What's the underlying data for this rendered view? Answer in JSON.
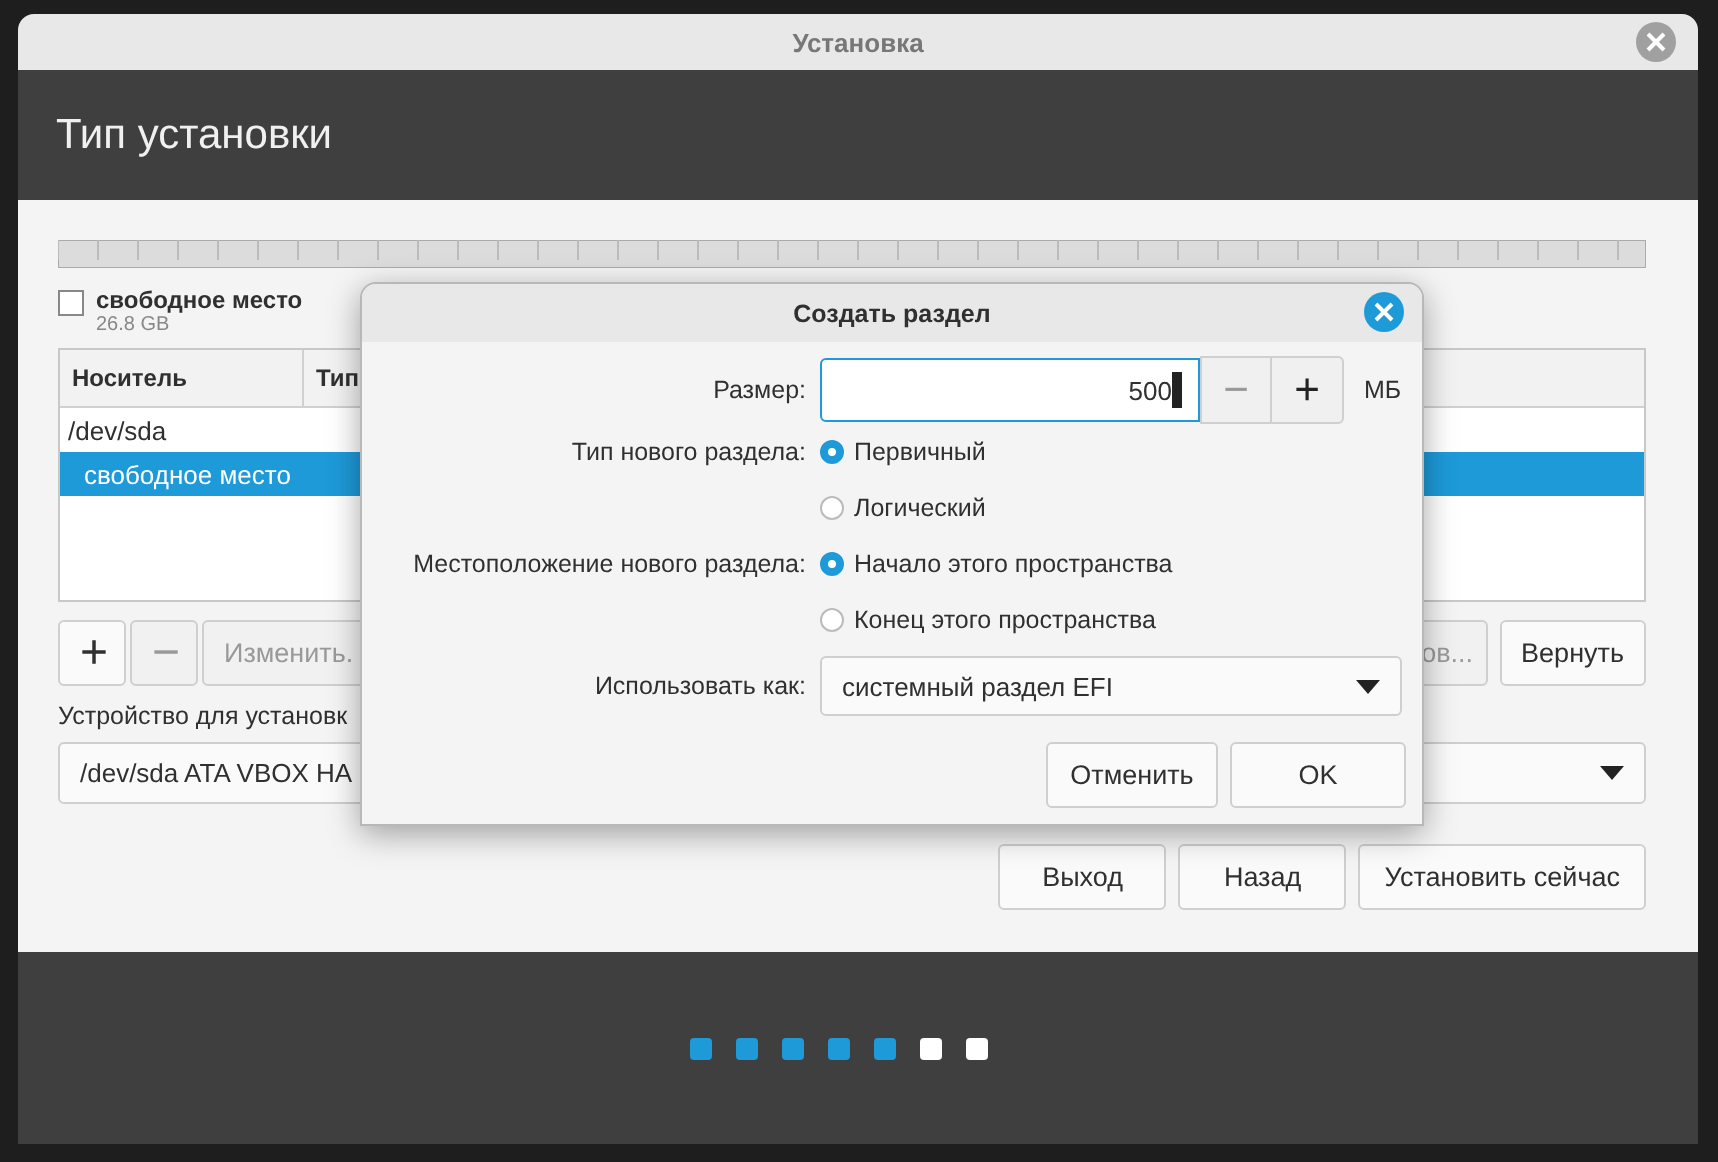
{
  "window": {
    "title": "Установка",
    "heading": "Тип установки"
  },
  "partition_legend": {
    "label": "свободное место",
    "size": "26.8 GB",
    "checked": false
  },
  "table": {
    "columns": [
      "Носитель",
      "Тип"
    ],
    "rows": [
      {
        "text": "/dev/sda",
        "selected": false,
        "indent": false
      },
      {
        "text": "свободное место",
        "selected": true,
        "indent": true
      }
    ]
  },
  "partition_buttons": [
    {
      "label": "+",
      "kind": "icon",
      "disabled": false
    },
    {
      "label": "−",
      "kind": "icon",
      "disabled": true
    },
    {
      "label": "Изменить.",
      "kind": "text",
      "disabled": true
    }
  ],
  "partition_buttons_right": [
    {
      "label": "ов...",
      "disabled": true
    },
    {
      "label": "Вернуть",
      "disabled": false
    }
  ],
  "device": {
    "label": "Устройство для установк",
    "value": "/dev/sda ATA VBOX HA"
  },
  "actions": [
    "Выход",
    "Назад",
    "Установить сейчас"
  ],
  "progress": [
    {
      "done": true
    },
    {
      "done": true
    },
    {
      "done": true
    },
    {
      "done": true
    },
    {
      "done": true
    },
    {
      "done": false
    },
    {
      "done": false
    }
  ],
  "dialog": {
    "title": "Создать раздел",
    "size": {
      "label": "Размер:",
      "value": "500",
      "minus": "−",
      "plus": "+",
      "unit": "МБ"
    },
    "radio_groups": [
      {
        "label": "Тип нового раздела:",
        "options": [
          {
            "label": "Первичный",
            "selected": true
          },
          {
            "label": "Логический",
            "selected": false
          }
        ]
      },
      {
        "label": "Местоположение нового раздела:",
        "options": [
          {
            "label": "Начало этого пространства",
            "selected": true
          },
          {
            "label": "Конец этого пространства",
            "selected": false
          }
        ]
      }
    ],
    "use_as": {
      "label": "Использовать как:",
      "value": "системный раздел EFI"
    },
    "buttons": [
      "Отменить",
      "OK"
    ]
  }
}
